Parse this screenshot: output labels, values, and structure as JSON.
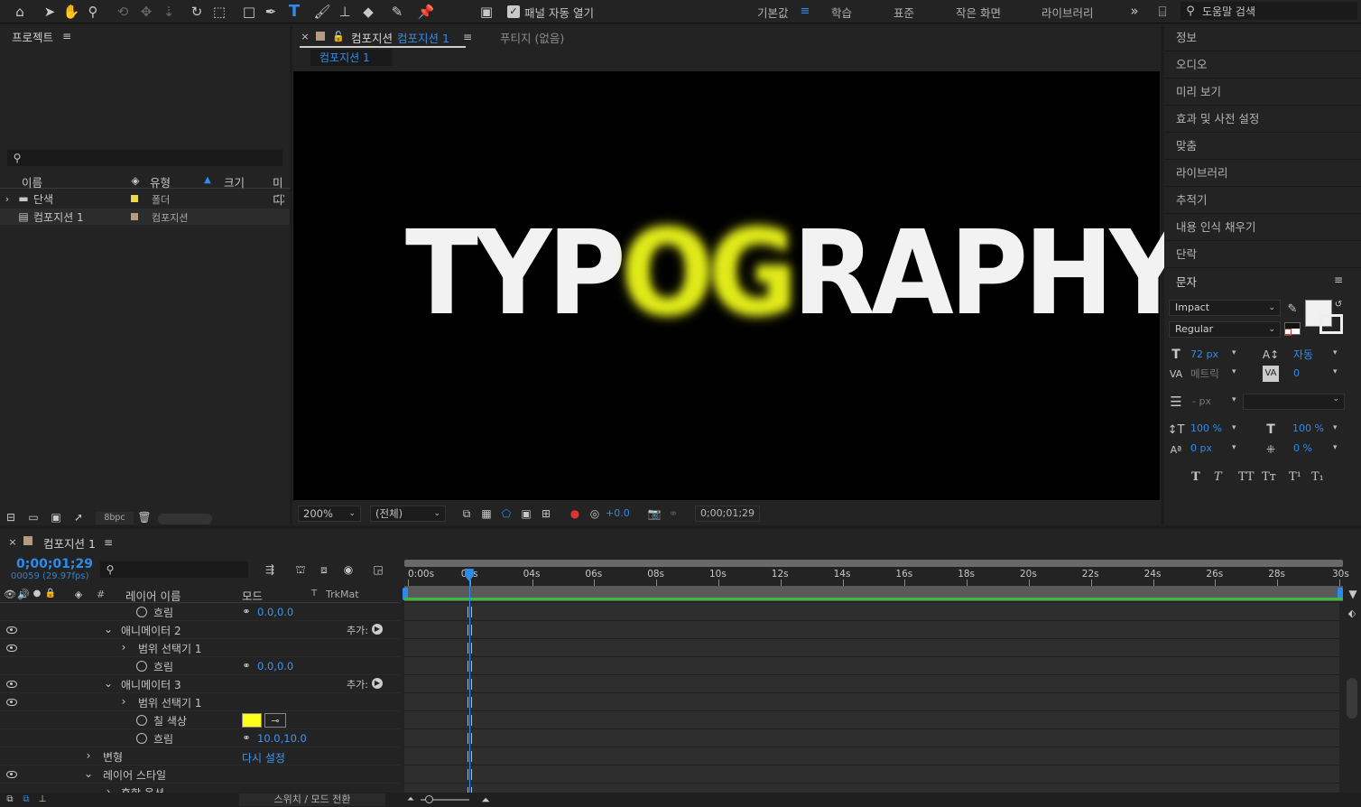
{
  "toolbar": {
    "auto_open_panel": "패널 자동 열기",
    "workspaces": [
      "기본값",
      "학습",
      "표준",
      "작은 화면",
      "라이브러리"
    ],
    "search_placeholder": "도움말 검색",
    "icons": [
      "home-icon",
      "selection-icon",
      "hand-icon",
      "zoom-icon",
      "orbit-icon",
      "pan-icon",
      "dolly-icon",
      "rotate-icon",
      "pan-behind-icon",
      "rectangle-icon",
      "pen-icon",
      "type-icon",
      "brush-icon",
      "clone-stamp-icon",
      "eraser-icon",
      "roto-brush-icon",
      "puppet-pin-icon"
    ]
  },
  "project": {
    "tab": "프로젝트",
    "columns": {
      "name": "이름",
      "type": "유형",
      "size": "크기",
      "media": "미디"
    },
    "items": [
      {
        "name": "단색",
        "type": "폴더",
        "color": "#e8d84a"
      },
      {
        "name": "컴포지션 1",
        "type": "컴포지션",
        "color": "#b59c80"
      }
    ],
    "bpc": "8bpc"
  },
  "viewer": {
    "tab_prefix": "컴포지션",
    "tab_name": "컴포지션 1",
    "footage_tab": "푸티지 (없음)",
    "breadcrumb": "컴포지션 1",
    "text_left": "TYP",
    "text_glow": "OG",
    "text_right": "RAPHY",
    "zoom": "200%",
    "resolution": "(전체)",
    "exposure": "+0.0",
    "timecode": "0;00;01;29"
  },
  "right_panel": {
    "items": [
      "정보",
      "오디오",
      "미리 보기",
      "효과 및 사전 설정",
      "맞춤",
      "라이브러리",
      "추적기",
      "내용 인식 채우기",
      "단락"
    ],
    "character": {
      "title": "문자",
      "font": "Impact",
      "style": "Regular",
      "size": "72 px",
      "leading": "자동",
      "kerning": "메트릭",
      "tracking": "0",
      "stroke": "- px",
      "vscale": "100 %",
      "hscale": "100 %",
      "baseline": "0 px",
      "tsume": "0 %",
      "style_buttons": [
        "T",
        "T",
        "TT",
        "Tт",
        "T¹",
        "T₁"
      ]
    }
  },
  "timeline": {
    "tab": "컴포지션 1",
    "timecode": "0;00;01;29",
    "frames": "00059 (29.97fps)",
    "columns": {
      "num": "#",
      "layer_name": "레이어 이름",
      "mode": "모드",
      "t": "T",
      "trkmat": "TrkMat"
    },
    "ticks": [
      "0:00s",
      "02s",
      "04s",
      "06s",
      "08s",
      "10s",
      "12s",
      "14s",
      "16s",
      "18s",
      "20s",
      "22s",
      "24s",
      "26s",
      "28s",
      "30s"
    ],
    "playhead_seconds": 1.97,
    "duration_seconds": 30,
    "add_label": "추가:",
    "rows": [
      {
        "label": "흐림",
        "value": "0.0,0.0",
        "eye": false
      },
      {
        "label": "애니메이터 2",
        "add": "추가:",
        "eye": true
      },
      {
        "label": "범위 선택기 1",
        "eye": true
      },
      {
        "label": "흐림",
        "value": "0.0,0.0",
        "eye": false
      },
      {
        "label": "애니메이터 3",
        "add": "추가:",
        "eye": true
      },
      {
        "label": "범위 선택기 1",
        "eye": true
      },
      {
        "label": "칠 색상",
        "eye": false,
        "color": "#ffff1a"
      },
      {
        "label": "흐림",
        "value": "10.0,10.0",
        "eye": false
      },
      {
        "label": "변형",
        "link": "다시 설정",
        "eye": false
      },
      {
        "label": "레이어 스타일",
        "eye": true
      },
      {
        "label": "혼합 옵션",
        "eye": false
      }
    ],
    "bottom_toggle": "스위치 / 모드 전환"
  }
}
